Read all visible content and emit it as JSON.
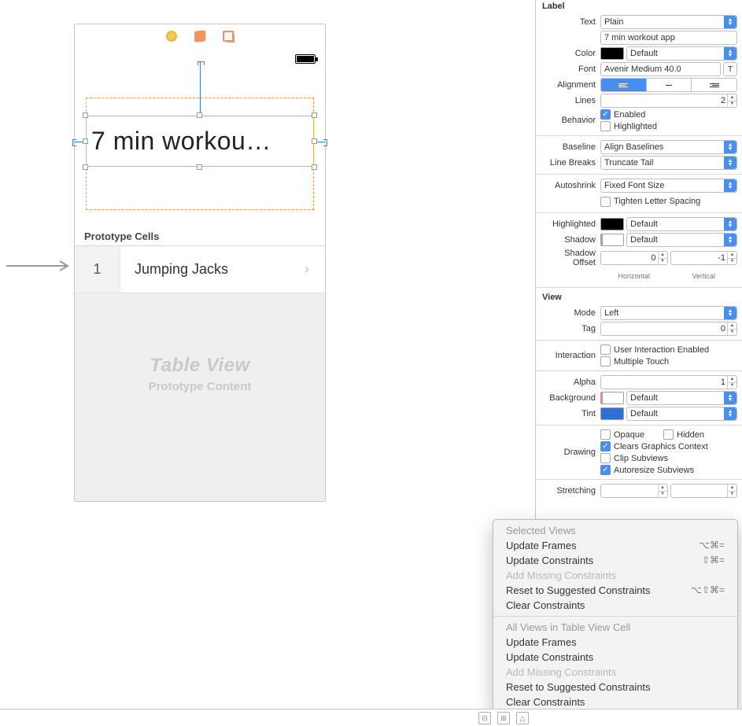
{
  "canvas": {
    "label_text": "7 min workou…",
    "prototype_header": "Prototype Cells",
    "cell": {
      "number": "1",
      "label": "Jumping Jacks"
    },
    "placeholder": {
      "title": "Table View",
      "subtitle": "Prototype Content"
    }
  },
  "inspector": {
    "label_section": "Label",
    "text_label": "Text",
    "text_mode": "Plain",
    "text_value": "7 min workout app",
    "color_label": "Color",
    "color_value": "Default",
    "font_label": "Font",
    "font_value": "Avenir Medium 40.0",
    "alignment_label": "Alignment",
    "lines_label": "Lines",
    "lines_value": "2",
    "behavior_label": "Behavior",
    "behavior_enabled": "Enabled",
    "behavior_highlighted": "Highlighted",
    "baseline_label": "Baseline",
    "baseline_value": "Align Baselines",
    "linebreaks_label": "Line Breaks",
    "linebreaks_value": "Truncate Tail",
    "autoshrink_label": "Autoshrink",
    "autoshrink_value": "Fixed Font Size",
    "tighten_label": "Tighten Letter Spacing",
    "highlighted_label": "Highlighted",
    "highlighted_value": "Default",
    "shadow_label": "Shadow",
    "shadow_value": "Default",
    "shadow_offset_label": "Shadow Offset",
    "shadow_h": "0",
    "shadow_v": "-1",
    "shadow_h_caption": "Horizontal",
    "shadow_v_caption": "Vertical",
    "view_section": "View",
    "mode_label": "Mode",
    "mode_value": "Left",
    "tag_label": "Tag",
    "tag_value": "0",
    "interaction_label": "Interaction",
    "interaction_uie": "User Interaction Enabled",
    "interaction_mt": "Multiple Touch",
    "alpha_label": "Alpha",
    "alpha_value": "1",
    "background_label": "Background",
    "background_value": "Default",
    "tint_label": "Tint",
    "tint_value": "Default",
    "drawing_label": "Drawing",
    "drawing_opaque": "Opaque",
    "drawing_hidden": "Hidden",
    "drawing_cgc": "Clears Graphics Context",
    "drawing_clip": "Clip Subviews",
    "drawing_auto": "Autoresize Subviews",
    "stretching_label": "Stretching"
  },
  "menu": {
    "group1_title": "Selected Views",
    "update_frames": "Update Frames",
    "update_frames_sc": "⌥⌘=",
    "update_constraints": "Update Constraints",
    "update_constraints_sc": "⇧⌘=",
    "add_missing": "Add Missing Constraints",
    "reset": "Reset to Suggested Constraints",
    "reset_sc": "⌥⇧⌘=",
    "clear": "Clear Constraints",
    "group2_title": "All Views in Table View Cell",
    "g2_update_frames": "Update Frames",
    "g2_update_constraints": "Update Constraints",
    "g2_add_missing": "Add Missing Constraints",
    "g2_reset": "Reset to Suggested Constraints",
    "g2_clear": "Clear Constraints"
  }
}
